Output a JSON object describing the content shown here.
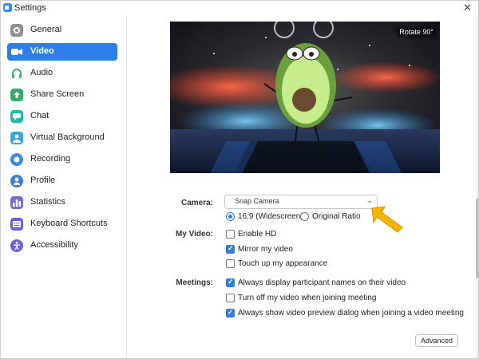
{
  "window": {
    "title": "Settings",
    "close": "✕"
  },
  "sidebar": {
    "items": [
      {
        "label": "General",
        "icon": "gear-icon",
        "color": "#8f8f8f"
      },
      {
        "label": "Video",
        "icon": "video-camera-icon",
        "color": "#ffffff"
      },
      {
        "label": "Audio",
        "icon": "headphones-icon",
        "color": "#3ab36a"
      },
      {
        "label": "Share Screen",
        "icon": "share-screen-icon",
        "color": "#37a866"
      },
      {
        "label": "Chat",
        "icon": "chat-icon",
        "color": "#24b7a8"
      },
      {
        "label": "Virtual Background",
        "icon": "virtual-background-icon",
        "color": "#33a4df"
      },
      {
        "label": "Recording",
        "icon": "recording-icon",
        "color": "#3b88e5"
      },
      {
        "label": "Profile",
        "icon": "profile-icon",
        "color": "#3d7de0"
      },
      {
        "label": "Statistics",
        "icon": "statistics-icon",
        "color": "#7b68cf"
      },
      {
        "label": "Keyboard Shortcuts",
        "icon": "keyboard-icon",
        "color": "#6d5fd8"
      },
      {
        "label": "Accessibility",
        "icon": "accessibility-icon",
        "color": "#6a60d8"
      }
    ],
    "selected": "Video"
  },
  "preview": {
    "rotate_label": "Rotate 90°"
  },
  "camera": {
    "label": "Camera:",
    "selected": "Snap Camera",
    "aspect_16_9": "16:9 (Widescreen)",
    "aspect_original": "Original Ratio"
  },
  "my_video": {
    "label": "My Video:",
    "enable_hd": "Enable HD",
    "mirror": "Mirror my video",
    "touch_up": "Touch up my appearance"
  },
  "meetings": {
    "label": "Meetings:",
    "display_names": "Always display participant names on their video",
    "turn_off_video": "Turn off my video when joining meeting",
    "show_preview": "Always show video preview dialog when joining a video meeting"
  },
  "buttons": {
    "advanced": "Advanced"
  },
  "colors": {
    "accent": "#2d7ee8",
    "highlight_arrow": "#f5b400"
  }
}
